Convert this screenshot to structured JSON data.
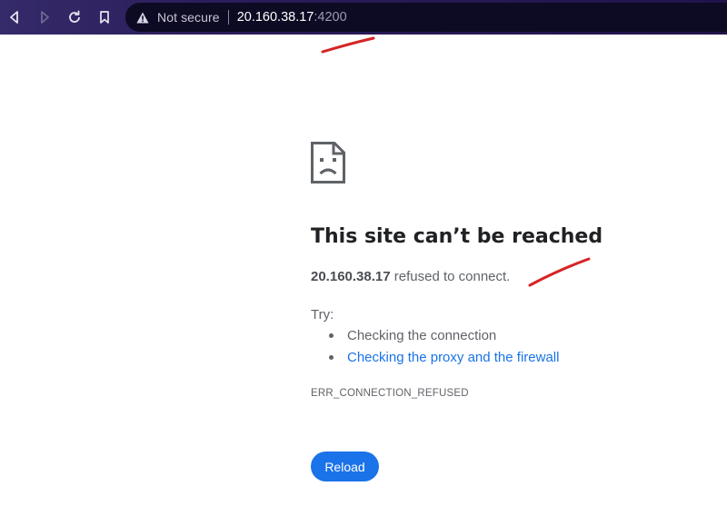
{
  "browser": {
    "address_bar": {
      "security_label": "Not secure",
      "url_host": "20.160.38.17",
      "url_port": ":4200"
    }
  },
  "page": {
    "title": "This site can’t be reached",
    "detail_host": "20.160.38.17",
    "detail_message": " refused to connect.",
    "try_label": "Try:",
    "suggestions": [
      "Checking the connection",
      "Checking the proxy and the firewall"
    ],
    "error_code": "ERR_CONNECTION_REFUSED",
    "reload_label": "Reload"
  },
  "colors": {
    "link": "#1a73e8",
    "button": "#1a73e8",
    "annotation": "#d62424"
  },
  "icons": [
    "back-icon",
    "forward-icon",
    "reload-icon",
    "bookmark-icon",
    "warning-icon",
    "sad-page-icon"
  ]
}
